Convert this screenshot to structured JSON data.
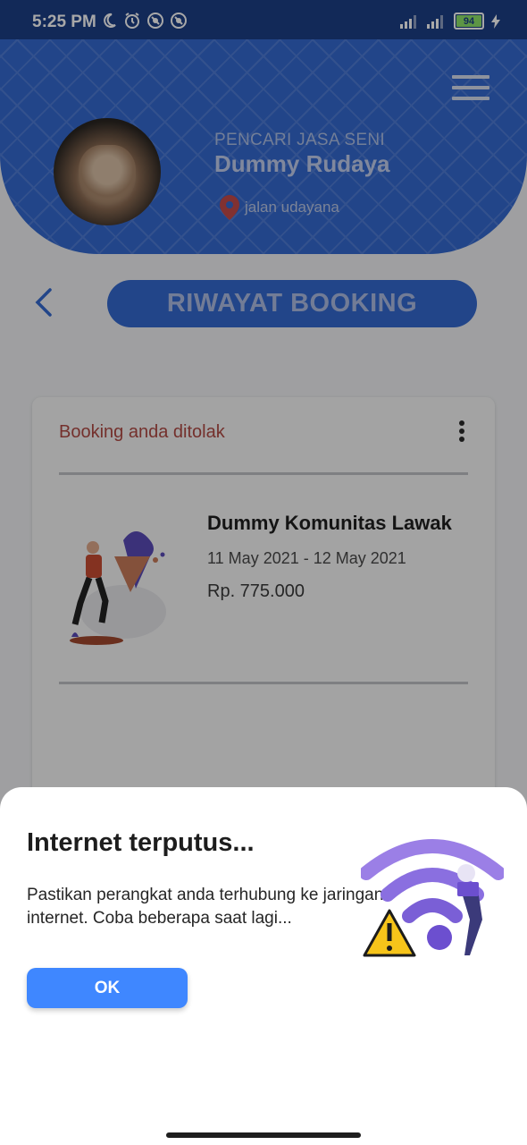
{
  "status_bar": {
    "time": "5:25 PM",
    "left_icons": [
      "moon-icon",
      "alarm-icon",
      "vpn-icon",
      "vpn-icon"
    ],
    "right_icons": [
      "signal-icon",
      "signal-icon",
      "battery-icon",
      "charging-icon"
    ],
    "battery_level": "94",
    "battery_color": "#8de36a"
  },
  "header": {
    "role": "PENCARI JASA SENI",
    "name": "Dummy Rudaya",
    "location": "jalan udayana",
    "menu_icon": "hamburger-menu-icon",
    "background_color": "#3469d0"
  },
  "page": {
    "title": "RIWAYAT BOOKING",
    "back_icon": "chevron-left-icon"
  },
  "booking": {
    "status": "Booking anda ditolak",
    "status_color": "#b04a44",
    "name": "Dummy Komunitas Lawak",
    "dates": "11 May 2021 - 12 May 2021",
    "price": "Rp. 775.000"
  },
  "dialog": {
    "title": "Internet terputus...",
    "message": "Pastikan perangkat anda terhubung ke jaringan internet. Coba beberapa saat lagi...",
    "ok_label": "OK",
    "ok_color": "#3f87ff",
    "illustration_icon": "wifi-warning-icon"
  }
}
